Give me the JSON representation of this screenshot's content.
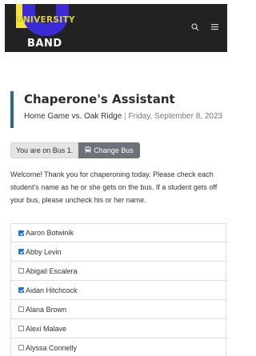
{
  "header": {
    "logo_line1": "UNIVERSITY",
    "logo_line2": "BAND",
    "search_icon": "search-icon",
    "menu_icon": "menu-icon"
  },
  "page": {
    "title": "Chaperone's Assistant",
    "event": "Home Game vs. Oak Ridge",
    "separator": "|",
    "date": "Friday, September 8, 2023"
  },
  "bus": {
    "status": "You are on Bus 1.",
    "change_label": "Change Bus",
    "change_icon": "bus-icon"
  },
  "welcome_text": "Welcome! Thank you for chaperoning today. Please check each student's name as he or she gets on the bus. If a student gets off your bus, please uncheck his or her name.",
  "students": [
    {
      "name": "Aaron Botwinik",
      "checked": true
    },
    {
      "name": "Abby Levin",
      "checked": true
    },
    {
      "name": "Abigail Escalera",
      "checked": false
    },
    {
      "name": "Aidan Hitchcock",
      "checked": true
    },
    {
      "name": "Alana Brown",
      "checked": false
    },
    {
      "name": "Alexi Malave",
      "checked": false
    },
    {
      "name": "Alyssa Connelly",
      "checked": false
    }
  ],
  "colors": {
    "header_bg": "#222222",
    "accent_border": "#2a6a8f",
    "checkbox_checked": "#1a73e8",
    "change_bus_button": "#6b7378"
  }
}
